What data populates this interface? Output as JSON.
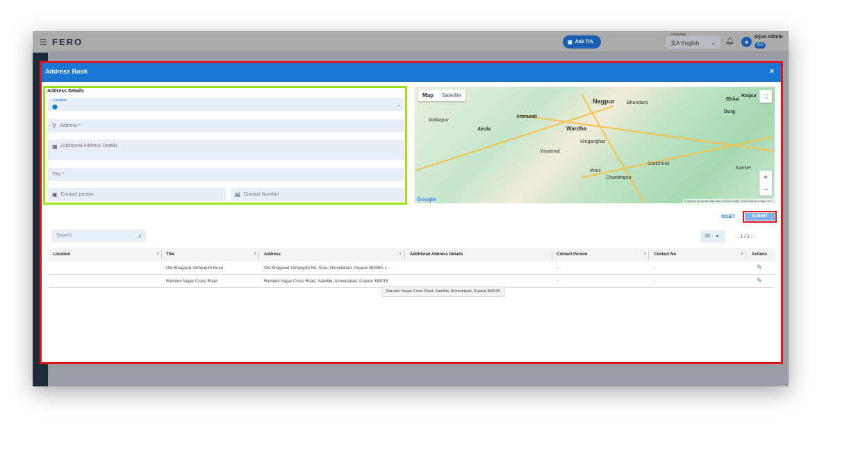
{
  "app": {
    "logo": "FERO",
    "ask_label": "Ask TIA",
    "language_label": "Language",
    "language_value": "English",
    "user_name": "Arjun Admin",
    "user_badge": "G-1"
  },
  "modal": {
    "title": "Address Book",
    "close": "×"
  },
  "form": {
    "section_title": "Address Details",
    "location_label": "Location",
    "address_placeholder": "Address *",
    "additional_placeholder": "Additional Address Details",
    "title_placeholder": "Title *",
    "contact_person_placeholder": "Contact person",
    "contact_number_placeholder": "Contact Number"
  },
  "map": {
    "tabs": [
      "Map",
      "Satellite"
    ],
    "cities": [
      "Nagpur",
      "Amravati",
      "Akola",
      "Wardha",
      "Yavatmal",
      "Chandrapur",
      "Bhilai",
      "Raipur",
      "Durg",
      "Malkapur",
      "Hinganghat",
      "Wani",
      "Gadchiroli",
      "Kanker",
      "Bhandara"
    ],
    "attribution": "Keyboard shortcuts   Map data ©2024 Google   Terms   Report a map error",
    "google": "Google",
    "zoom_in": "+",
    "zoom_out": "−"
  },
  "actions": {
    "reset": "RESET",
    "submit": "SUBMIT"
  },
  "list": {
    "search_placeholder": "Search",
    "page_size": "15",
    "page": "1 / 1",
    "columns": [
      "Location",
      "Title",
      "Address",
      "Additional Address Details",
      "Contact Person",
      "Contact No",
      "Actions"
    ],
    "rows": [
      {
        "location": "",
        "title": "Old Bhagavat Vidhyapith Road",
        "address": "Old Bhagavat Vidhyapith Rd, Sola, Ahmedabad, Gujarat 380060, I...",
        "additional": "",
        "contact_person": "-",
        "contact_no": "-"
      },
      {
        "location": "",
        "title": "Ramdev Nagar Cross Road",
        "address": "Ramdev Nagar Cross Road, Satellite, Ahmedabad, Gujarat 380015",
        "additional": "",
        "contact_person": "-",
        "contact_no": "-"
      }
    ],
    "tooltip": "Ramdev Nagar Cross Road, Satellite, Ahmedabad, Gujarat 380015"
  }
}
